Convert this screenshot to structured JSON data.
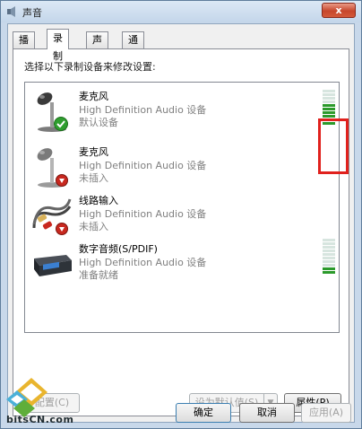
{
  "window": {
    "title": "声音",
    "close_label": "x"
  },
  "tabs": [
    {
      "label": "播放",
      "active": false
    },
    {
      "label": "录制",
      "active": true
    },
    {
      "label": "声音",
      "active": false
    },
    {
      "label": "通信",
      "active": false
    }
  ],
  "prompt": "选择以下录制设备来修改设置:",
  "devices": [
    {
      "name": "麦克风",
      "description": "High Definition Audio 设备",
      "status": "默认设备",
      "icon": "microphone-icon",
      "badge": "default-check-icon",
      "level_fraction": 0.6
    },
    {
      "name": "麦克风",
      "description": "High Definition Audio 设备",
      "status": "未插入",
      "icon": "microphone-icon",
      "badge": "unplugged-icon"
    },
    {
      "name": "线路输入",
      "description": "High Definition Audio 设备",
      "status": "未插入",
      "icon": "line-in-cable-icon",
      "badge": "unplugged-icon"
    },
    {
      "name": "数字音频(S/PDIF)",
      "description": "High Definition Audio 设备",
      "status": "准备就绪",
      "icon": "spdif-device-icon",
      "level_fraction": 0.2
    }
  ],
  "buttons": {
    "configure": "配置(C)",
    "set_default": "设为默认值(S)",
    "properties": "属性(P)",
    "ok": "确定",
    "cancel": "取消",
    "apply": "应用(A)"
  },
  "watermark": {
    "text": "bitsCN.com"
  },
  "colors": {
    "highlight_border": "#e0211d",
    "meter_on": "#2b9a2b",
    "meter_off": "#d7e5df"
  }
}
